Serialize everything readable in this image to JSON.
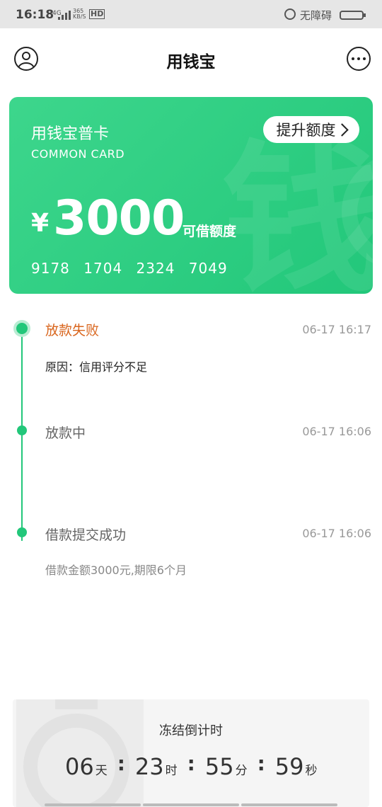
{
  "status_bar": {
    "time": "16:18",
    "signal_label": "4G",
    "speed_value": "365",
    "speed_unit": "KB/S",
    "hd_label": "HD",
    "accessibility_text": "无障碍"
  },
  "header": {
    "title": "用钱宝"
  },
  "card": {
    "name": "用钱宝普卡",
    "subtitle": "COMMON CARD",
    "upgrade_label": "提升额度",
    "currency_symbol": "¥",
    "amount": "3000",
    "amount_label": "可借额度",
    "card_number": [
      "9178",
      "1704",
      "2324",
      "7049"
    ],
    "watermark": "钱",
    "accent_color": "#22c77a"
  },
  "timeline": [
    {
      "title": "放款失败",
      "time": "06-17 16:17",
      "desc": "原因：信用评分不足",
      "title_color": "#d9661e",
      "desc_color": "#222222"
    },
    {
      "title": "放款中",
      "time": "06-17 16:06",
      "desc": "",
      "title_color": "#666666",
      "desc_color": "#888888"
    },
    {
      "title": "借款提交成功",
      "time": "06-17 16:06",
      "desc": "借款金额3000元,期限6个月",
      "title_color": "#666666",
      "desc_color": "#888888"
    }
  ],
  "countdown": {
    "label": "冻结倒计时",
    "days": "06",
    "days_unit": "天",
    "hours": "23",
    "hours_unit": "时",
    "minutes": "55",
    "minutes_unit": "分",
    "seconds": "59",
    "seconds_unit": "秒",
    "separator": ":"
  }
}
